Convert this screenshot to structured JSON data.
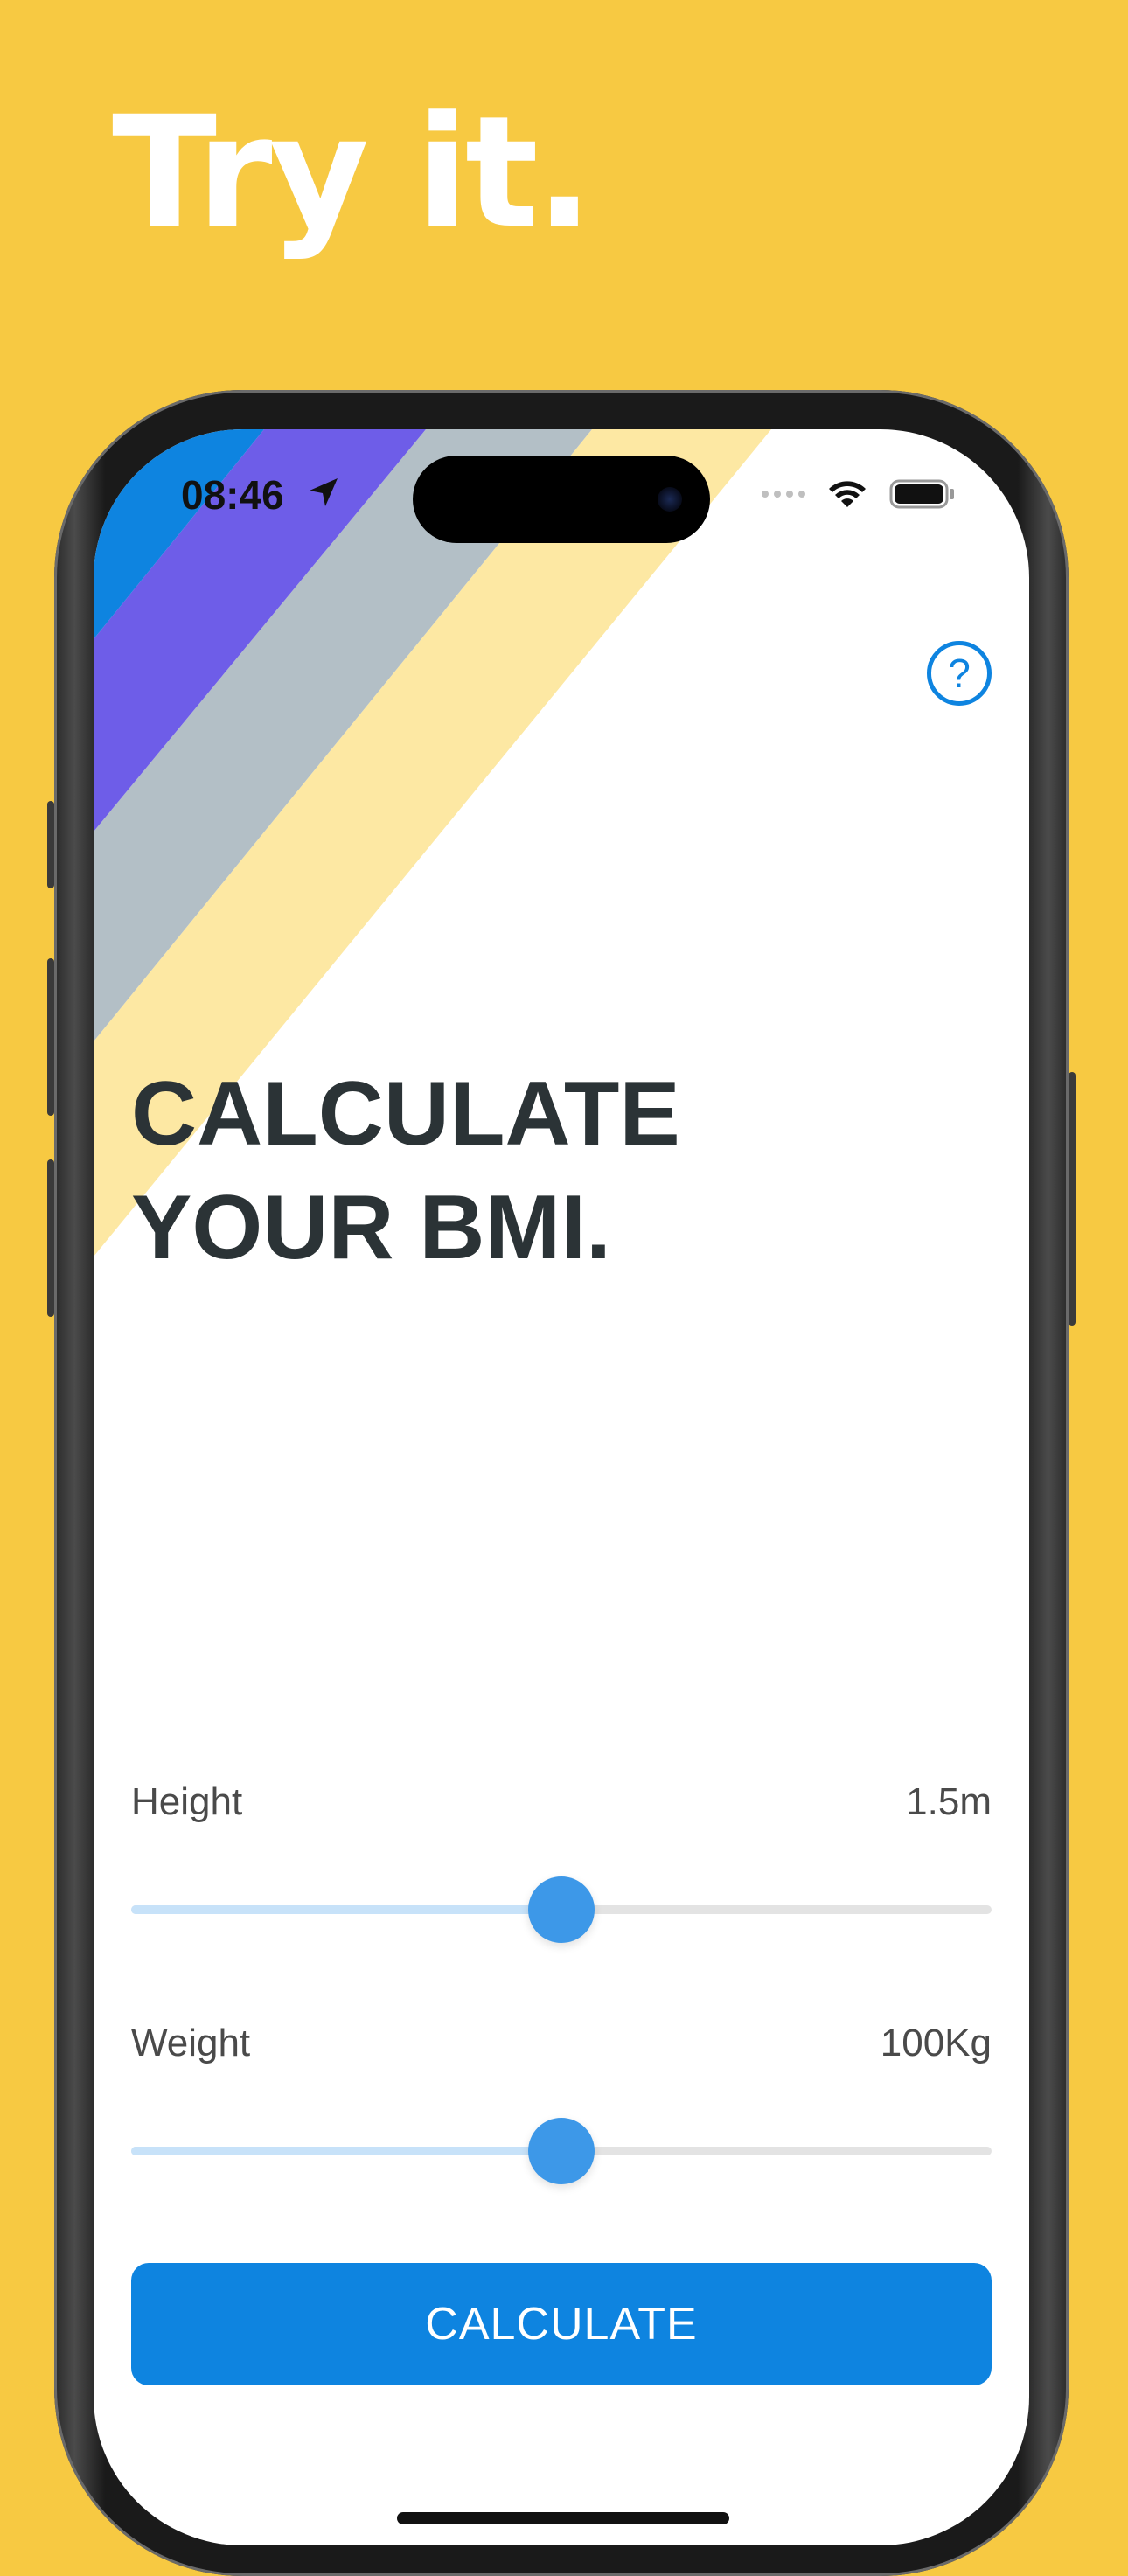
{
  "headline": "Try it.",
  "status_bar": {
    "time": "08:46"
  },
  "screen": {
    "title_line1": "CALCULATE",
    "title_line2": "YOUR BMI.",
    "help_label": "?",
    "height": {
      "label": "Height",
      "value": "1.5m",
      "level": 0.5
    },
    "weight": {
      "label": "Weight",
      "value": "100Kg",
      "level": 0.5
    },
    "calculate_label": "CALCULATE"
  },
  "colors": {
    "background": "#F7C942",
    "accent": "#0E84E0",
    "stripe_blue": "#0E84E0",
    "stripe_purple": "#6E5DE8",
    "stripe_gray": "#B3BFC6",
    "stripe_yellow": "#FDE8A3",
    "title_text": "#2B3336"
  },
  "icons": {
    "location": "location-arrow-icon",
    "wifi": "wifi-icon",
    "battery": "battery-icon",
    "help": "question-circle-icon"
  }
}
